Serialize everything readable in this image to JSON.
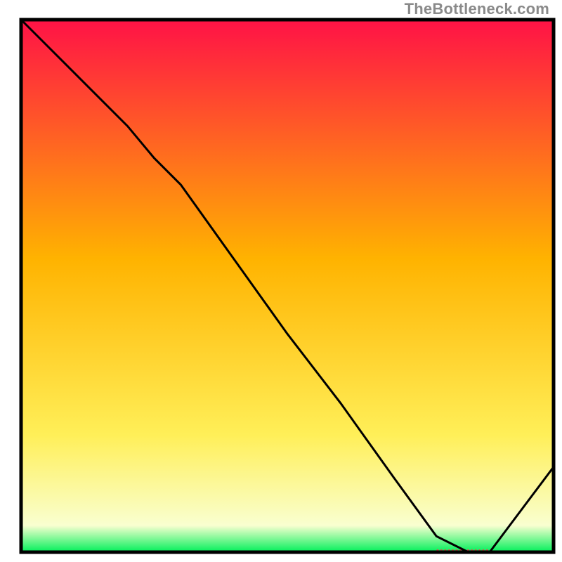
{
  "watermark": "TheBottleneck.com",
  "chart_data": {
    "type": "line",
    "title": "",
    "xlabel": "",
    "ylabel": "",
    "xlim": [
      0,
      100
    ],
    "ylim": [
      0,
      100
    ],
    "grid": false,
    "gradient_stops": [
      {
        "offset": 0.0,
        "color": "#ff1246"
      },
      {
        "offset": 0.45,
        "color": "#ffb300"
      },
      {
        "offset": 0.78,
        "color": "#ffef58"
      },
      {
        "offset": 0.95,
        "color": "#f9ffd0"
      },
      {
        "offset": 1.0,
        "color": "#00f05a"
      }
    ],
    "series": [
      {
        "name": "bottleneck-curve",
        "color": "#000000",
        "x": [
          0,
          8,
          20,
          25,
          30,
          40,
          50,
          60,
          70,
          78,
          84,
          88,
          100
        ],
        "y": [
          100,
          92,
          80,
          74,
          69,
          55,
          41,
          28,
          14,
          3,
          0,
          0,
          16
        ]
      }
    ],
    "marker_zone": {
      "name": "optimal-band",
      "color": "#e34a4a",
      "x_start": 78,
      "x_end": 88,
      "y": 0
    }
  }
}
